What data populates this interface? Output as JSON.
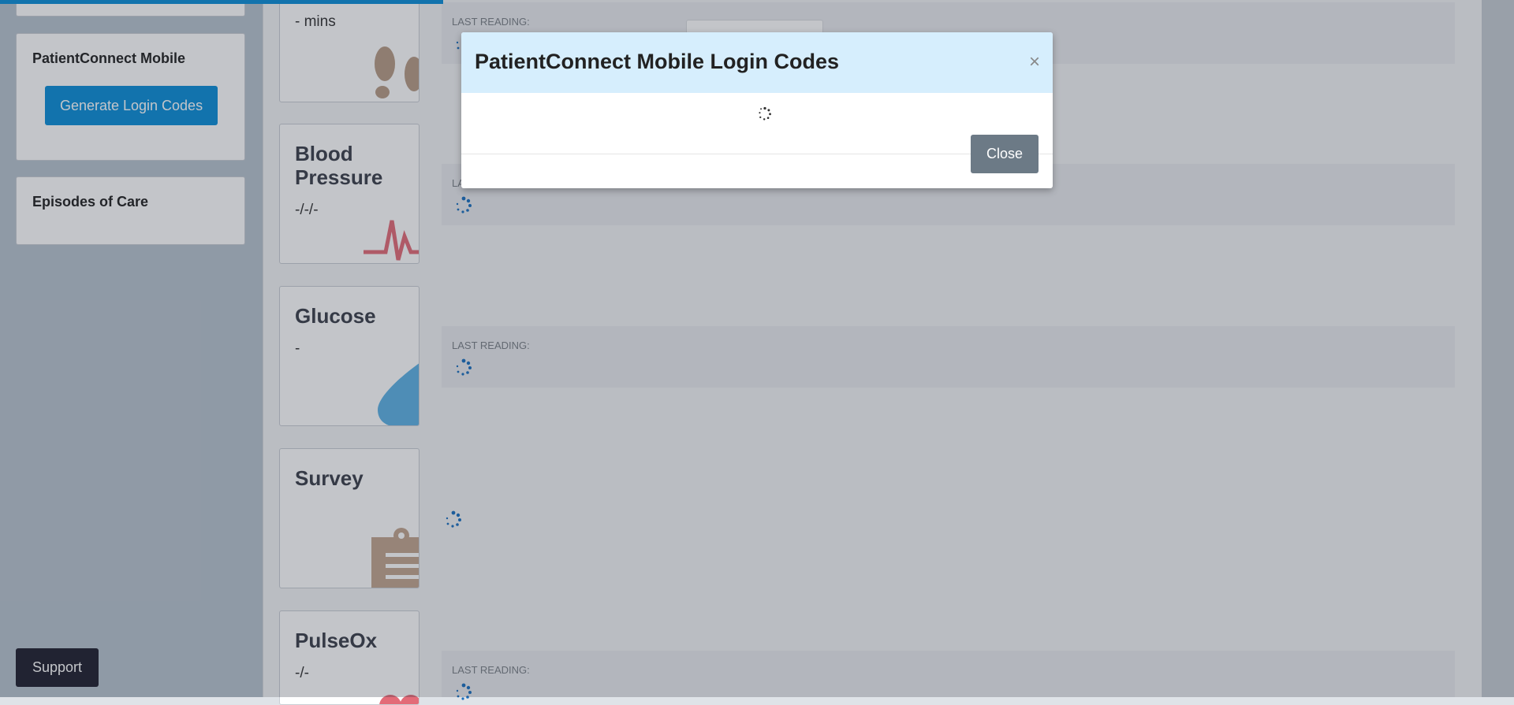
{
  "sidebar": {
    "patientconnect_title": "PatientConnect Mobile",
    "generate_button": "Generate Login Codes",
    "episodes_title": "Episodes of Care",
    "support_button": "Support"
  },
  "metrics": [
    {
      "title": "",
      "value": "- mins",
      "icon": "footprints-icon"
    },
    {
      "title": "Blood Pressure",
      "value": "-/-/-",
      "icon": "heartbeat-icon"
    },
    {
      "title": "Glucose",
      "value": "-",
      "icon": "droplet-icon"
    },
    {
      "title": "Survey",
      "value": "",
      "icon": "clipboard-icon"
    },
    {
      "title": "PulseOx",
      "value": "-/-",
      "icon": "heart-icon"
    }
  ],
  "reading_label": "LAST READING:",
  "modal": {
    "title": "PatientConnect Mobile Login Codes",
    "close_x": "×",
    "close_button": "Close"
  },
  "colors": {
    "primary": "#0b8ed9",
    "modal_header": "#d6eefd",
    "close_button": "#6c7a86"
  }
}
